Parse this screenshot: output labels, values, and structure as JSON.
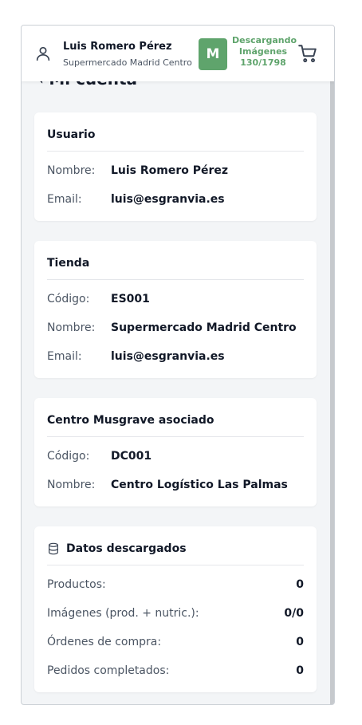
{
  "header": {
    "user_name": "Luis Romero Pérez",
    "store_name": "Supermercado Madrid Centro",
    "logo_letter": "M",
    "download_line1": "Descargando",
    "download_line2": "Imágenes",
    "download_progress": "130/1798",
    "accent_color": "#5fa46c"
  },
  "page": {
    "title": "Mi cuenta"
  },
  "usuario": {
    "title": "Usuario",
    "rows": [
      {
        "label": "Nombre:",
        "value": "Luis Romero Pérez"
      },
      {
        "label": "Email:",
        "value": "luis@esgranvia.es"
      }
    ]
  },
  "tienda": {
    "title": "Tienda",
    "rows": [
      {
        "label": "Código:",
        "value": "ES001"
      },
      {
        "label": "Nombre:",
        "value": "Supermercado Madrid Centro"
      },
      {
        "label": "Email:",
        "value": "luis@esgranvia.es"
      }
    ]
  },
  "centro": {
    "title": "Centro Musgrave asociado",
    "rows": [
      {
        "label": "Código:",
        "value": "DC001"
      },
      {
        "label": "Nombre:",
        "value": "Centro Logístico Las Palmas"
      }
    ]
  },
  "datos": {
    "title": "Datos descargados",
    "icon": "database-icon",
    "rows": [
      {
        "label": "Productos:",
        "value": "0"
      },
      {
        "label": "Imágenes (prod. + nutric.):",
        "value": "0/0"
      },
      {
        "label": "Órdenes de compra:",
        "value": "0"
      },
      {
        "label": "Pedidos completados:",
        "value": "0"
      }
    ]
  }
}
